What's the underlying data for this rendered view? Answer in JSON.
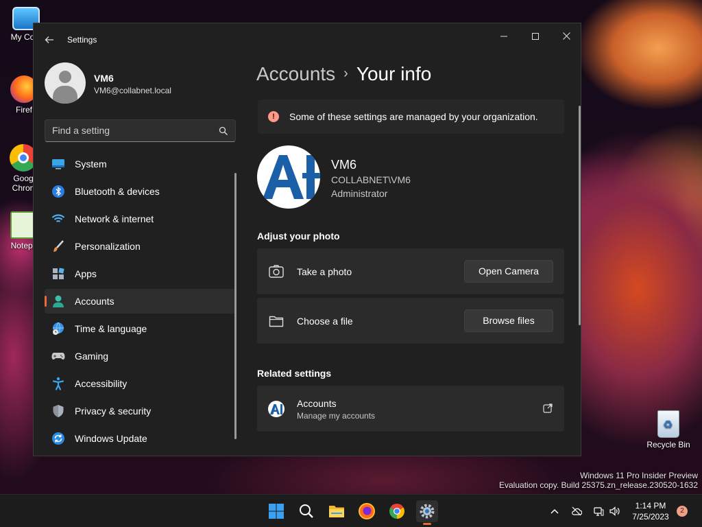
{
  "desktop": {
    "icons": [
      {
        "label": "My Com",
        "icon": "computer-icon"
      },
      {
        "label": "Firef",
        "icon": "firefox-icon"
      },
      {
        "label": "Goog Chron",
        "icon": "chrome-icon"
      },
      {
        "label": "Notepa",
        "icon": "notepad-icon"
      },
      {
        "label": "Recycle Bin",
        "icon": "recycle-bin-icon"
      }
    ],
    "watermark_line1": "Windows 11 Pro Insider Preview",
    "watermark_line2": "Evaluation copy. Build 25375.zn_release.230520-1632"
  },
  "window": {
    "title": "Settings",
    "back_icon": "back-arrow-icon",
    "controls": {
      "minimize": "—",
      "maximize": "☐",
      "close": "✕"
    }
  },
  "profile": {
    "name": "VM6",
    "email": "VM6@collabnet.local"
  },
  "search": {
    "placeholder": "Find a setting",
    "icon": "search-icon"
  },
  "nav": {
    "items": [
      {
        "label": "System",
        "icon": "system-icon"
      },
      {
        "label": "Bluetooth & devices",
        "icon": "bluetooth-icon"
      },
      {
        "label": "Network & internet",
        "icon": "wifi-icon"
      },
      {
        "label": "Personalization",
        "icon": "brush-icon"
      },
      {
        "label": "Apps",
        "icon": "apps-icon"
      },
      {
        "label": "Accounts",
        "icon": "accounts-icon",
        "active": true
      },
      {
        "label": "Time & language",
        "icon": "globe-clock-icon"
      },
      {
        "label": "Gaming",
        "icon": "gamepad-icon"
      },
      {
        "label": "Accessibility",
        "icon": "accessibility-icon"
      },
      {
        "label": "Privacy & security",
        "icon": "shield-icon"
      },
      {
        "label": "Windows Update",
        "icon": "update-icon"
      }
    ]
  },
  "breadcrumb": {
    "parent": "Accounts",
    "separator": "›",
    "current": "Your info"
  },
  "notice": {
    "text": "Some of these settings are managed by your organization."
  },
  "user": {
    "name": "VM6",
    "domain": "COLLABNET\\VM6",
    "role": "Administrator"
  },
  "adjust_photo": {
    "heading": "Adjust your photo",
    "take_photo": {
      "label": "Take a photo",
      "button": "Open Camera"
    },
    "choose_file": {
      "label": "Choose a file",
      "button": "Browse files"
    }
  },
  "related": {
    "heading": "Related settings",
    "accounts": {
      "label": "Accounts",
      "sub": "Manage my accounts"
    }
  },
  "taskbar": {
    "apps": [
      "start-icon",
      "search-icon",
      "file-explorer-icon",
      "firefox-icon",
      "chrome-icon",
      "settings-icon"
    ],
    "clock_time": "1:14 PM",
    "clock_date": "7/25/2023",
    "notification_count": "2"
  },
  "colors": {
    "window_bg": "#202020",
    "card_bg": "#2b2b2b",
    "accent": "#e86a3a",
    "taskbar_bg": "#1c1c1c"
  }
}
